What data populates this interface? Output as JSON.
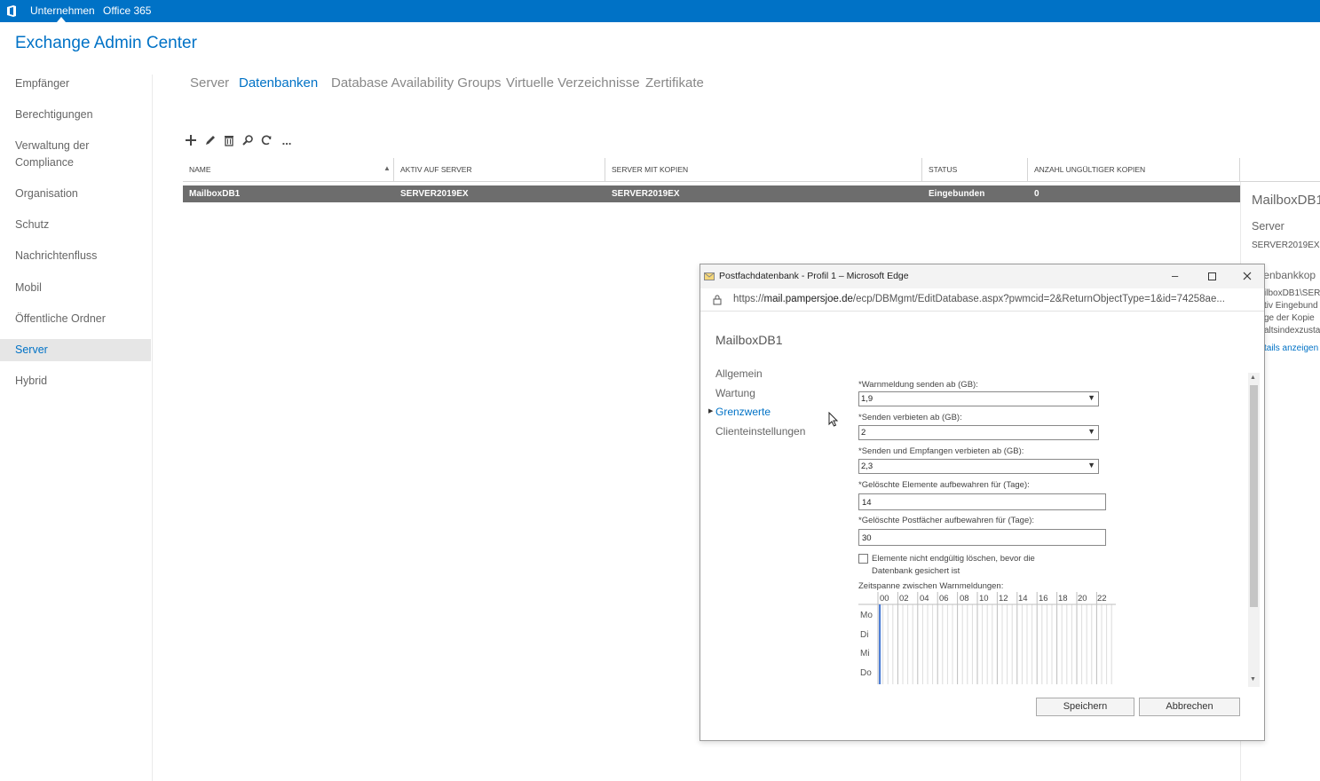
{
  "topbar": {
    "tabs": [
      "Unternehmen",
      "Office 365"
    ]
  },
  "app": {
    "title": "Exchange Admin Center"
  },
  "sidebar": {
    "items": [
      {
        "label": "Empfänger"
      },
      {
        "label": "Berechtigungen"
      },
      {
        "label": "Verwaltung der\nCompliance"
      },
      {
        "label": "Organisation"
      },
      {
        "label": "Schutz"
      },
      {
        "label": "Nachrichtenfluss"
      },
      {
        "label": "Mobil"
      },
      {
        "label": "Öffentliche Ordner"
      },
      {
        "label": "Server"
      },
      {
        "label": "Hybrid"
      }
    ],
    "selected": "Server"
  },
  "subtabs": [
    "Server",
    "Datenbanken",
    "Database Availability Groups",
    "Virtuelle Verzeichnisse",
    "Zertifikate"
  ],
  "toolbar": {
    "icons": [
      "add-icon",
      "edit-icon",
      "delete-icon",
      "search-icon",
      "refresh-icon",
      "more-icon"
    ],
    "more_label": "..."
  },
  "table": {
    "columns": [
      "NAME",
      "AKTIV AUF SERVER",
      "SERVER MIT KOPIEN",
      "STATUS",
      "ANZAHL UNGÜLTIGER KOPIEN"
    ],
    "rows": [
      [
        "MailboxDB1",
        "SERVER2019EX",
        "SERVER2019EX",
        "Eingebunden",
        "0"
      ]
    ]
  },
  "details": {
    "title": "MailboxDB1",
    "server_label": "Server",
    "server_value": "SERVER2019EX",
    "section": "tenbankkop",
    "lines": [
      "ilboxDB1\\SER",
      "tiv Eingebund",
      "ge der Kopie",
      "altsindexzusta"
    ],
    "link": "tails anzeigen"
  },
  "popup": {
    "window_title": "Postfachdatenbank - Profil 1 – Microsoft Edge",
    "url_prefix": "https://",
    "url_host": "mail.pampersjoe.de",
    "url_path": "/ecp/DBMgmt/EditDatabase.aspx?pwmcid=2&ReturnObjectType=1&id=74258ae...",
    "title": "MailboxDB1",
    "nav": [
      "Allgemein",
      "Wartung",
      "Grenzwerte",
      "Clienteinstellungen"
    ],
    "nav_active": "Grenzwerte",
    "fields": {
      "warn_label": "*Warnmeldung senden ab (GB):",
      "warn_value": "1,9",
      "send_label": "*Senden verbieten ab (GB):",
      "send_value": "2",
      "sendrecv_label": "*Senden und Empfangen verbieten ab (GB):",
      "sendrecv_value": "2,3",
      "deleted_items_label": "*Gelöschte Elemente aufbewahren für (Tage):",
      "deleted_items_value": "14",
      "deleted_mbx_label": "*Gelöschte Postfächer aufbewahren für (Tage):",
      "deleted_mbx_value": "30",
      "checkbox_label": "Elemente nicht endgültig löschen, bevor die Datenbank gesichert ist",
      "checkbox_checked": false,
      "schedule_label": "Zeitspanne zwischen Warnmeldungen:"
    },
    "schedule": {
      "hours": [
        "00",
        "02",
        "04",
        "06",
        "08",
        "10",
        "12",
        "14",
        "16",
        "18",
        "20",
        "22"
      ],
      "days": [
        "Mo",
        "Di",
        "Mi",
        "Do"
      ]
    },
    "buttons": {
      "save": "Speichern",
      "cancel": "Abbrechen"
    }
  }
}
